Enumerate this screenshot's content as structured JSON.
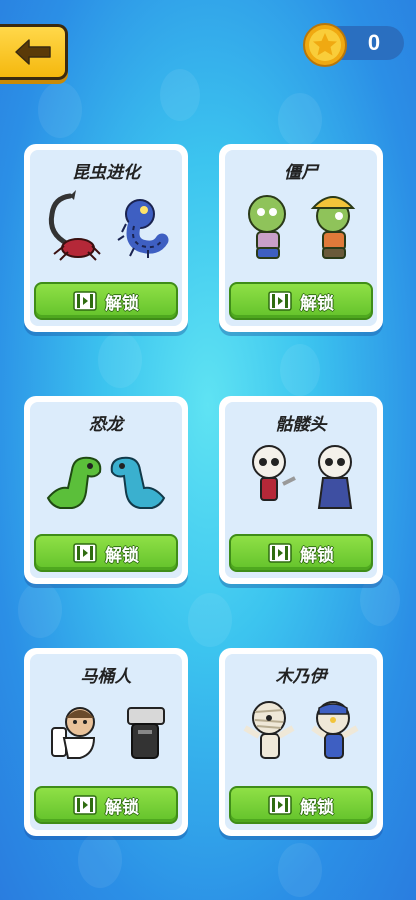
{
  "coins": {
    "count": "0"
  },
  "unlock_label": "解锁",
  "colors": {
    "button_green": "#63c22b",
    "back_yellow": "#f5b80e",
    "coin_gold": "#f7c531"
  },
  "cards": [
    {
      "title": "昆虫进化",
      "icon": "video-ad-icon",
      "art": "scorpion-and-centipede"
    },
    {
      "title": "僵尸",
      "icon": "video-ad-icon",
      "art": "two-zombies"
    },
    {
      "title": "恐龙",
      "icon": "video-ad-icon",
      "art": "two-dinosaurs"
    },
    {
      "title": "骷髅头",
      "icon": "video-ad-icon",
      "art": "two-skeletons"
    },
    {
      "title": "马桶人",
      "icon": "video-ad-icon",
      "art": "toilet-man-and-camera-man"
    },
    {
      "title": "木乃伊",
      "icon": "video-ad-icon",
      "art": "two-mummies"
    }
  ]
}
